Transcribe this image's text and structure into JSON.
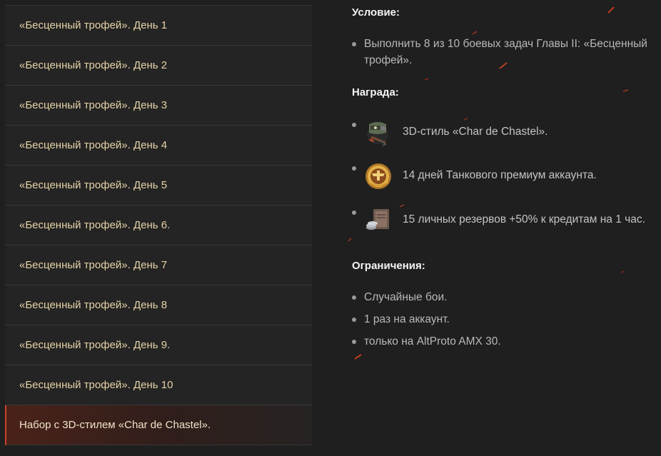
{
  "sidebar": {
    "items": [
      {
        "label": "«Бесценный трофей». День 1"
      },
      {
        "label": "«Бесценный трофей». День 2"
      },
      {
        "label": "«Бесценный трофей». День 3"
      },
      {
        "label": "«Бесценный трофей». День 4"
      },
      {
        "label": "«Бесценный трофей». День 5"
      },
      {
        "label": "«Бесценный трофей». День 6."
      },
      {
        "label": "«Бесценный трофей». День 7"
      },
      {
        "label": "«Бесценный трофей». День 8"
      },
      {
        "label": "«Бесценный трофей». День 9."
      },
      {
        "label": "«Бесценный трофей». День 10"
      },
      {
        "label": "Набор с 3D-стилем «Char de Chastel»."
      }
    ],
    "active_index": 10
  },
  "condition": {
    "heading": "Условие:",
    "items": [
      "Выполнить 8 из 10 боевых задач Главы II: «Бесценный трофей»."
    ]
  },
  "reward": {
    "heading": "Награда:",
    "items": [
      {
        "icon": "tank-style-icon",
        "text": "3D-стиль «Char de Chastel»."
      },
      {
        "icon": "premium-account-icon",
        "text": "14 дней Танкового премиум аккаунта."
      },
      {
        "icon": "personal-reserve-icon",
        "text": "15 личных резервов +50% к кредитам на 1 час."
      }
    ]
  },
  "restrictions": {
    "heading": "Ограничения:",
    "items": [
      "Случайные бои.",
      "1 раз на аккаунт.",
      "только на AltProto AMX 30."
    ]
  },
  "colors": {
    "background": "#1f1f1f",
    "sidebar_text": "#e6d3a6",
    "accent": "#c8432a"
  }
}
